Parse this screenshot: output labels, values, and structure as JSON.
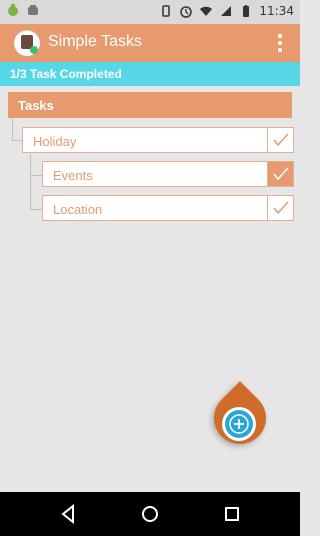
{
  "status_bar": {
    "time": "11:34",
    "icons": [
      "android-debug-icon",
      "robot-icon",
      "vibrate-icon",
      "alarm-icon",
      "wifi-icon",
      "signal-icon",
      "battery-icon"
    ]
  },
  "app_bar": {
    "title": "Simple Tasks",
    "app_icon": "task-list-icon",
    "overflow_icon": "more-vert-icon"
  },
  "progress": {
    "label": "1/3 Task Completed",
    "completed": 1,
    "total": 3
  },
  "tasks": {
    "title": "Tasks",
    "items": [
      {
        "label": "Holiday",
        "completed": false
      },
      {
        "label": "Events",
        "completed": true
      },
      {
        "label": "Location",
        "completed": false
      }
    ]
  },
  "fab": {
    "icon": "add-icon"
  },
  "nav_bar": {
    "icons": [
      "back-icon",
      "home-icon",
      "recents-icon"
    ]
  },
  "colors": {
    "accent": "#e79a6e",
    "progress_bg": "#57d6e6",
    "fab_orange": "#d06b2c",
    "fab_blue": "#2aa6d6",
    "background": "#e6e6e6"
  }
}
